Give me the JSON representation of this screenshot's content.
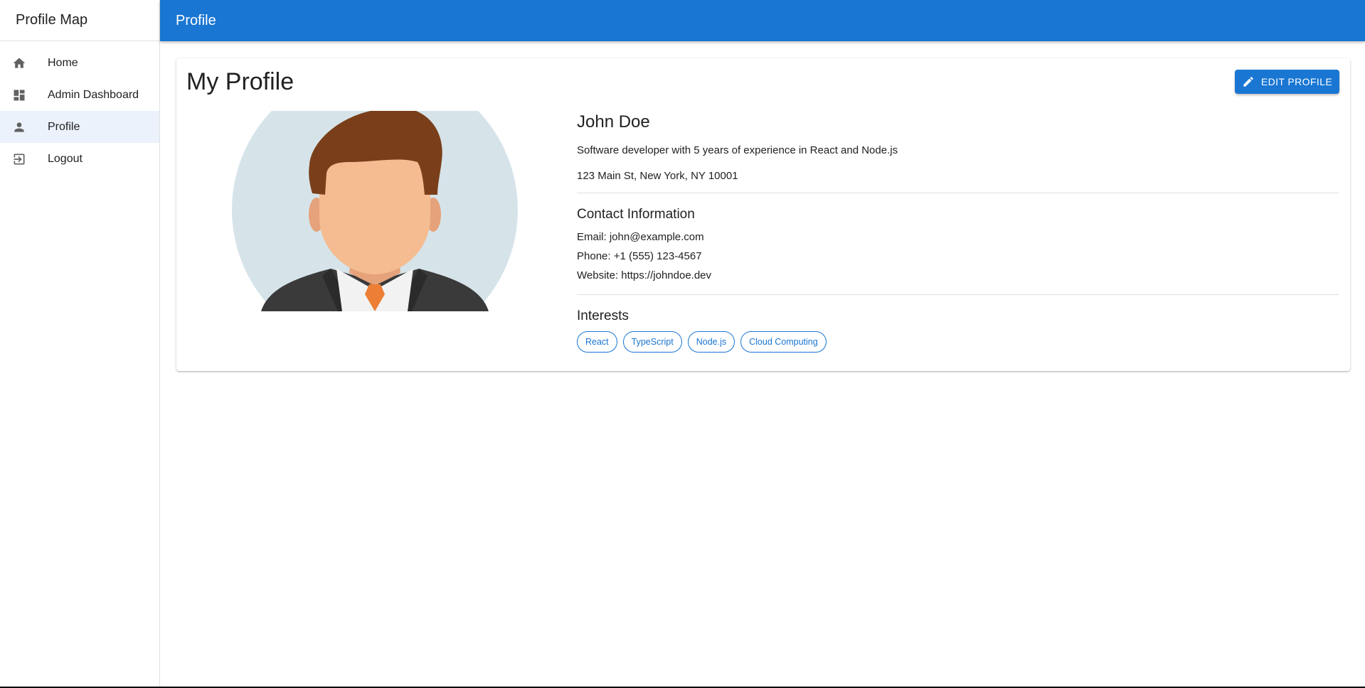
{
  "sidebar": {
    "title": "Profile Map",
    "items": [
      {
        "label": "Home",
        "icon": "home-icon"
      },
      {
        "label": "Admin Dashboard",
        "icon": "dashboard-icon"
      },
      {
        "label": "Profile",
        "icon": "person-icon",
        "selected": true
      },
      {
        "label": "Logout",
        "icon": "logout-icon"
      }
    ]
  },
  "appbar": {
    "title": "Profile"
  },
  "card": {
    "title": "My Profile",
    "edit_label": "EDIT PROFILE",
    "edit_icon": "pencil-icon",
    "avatar_icon": "person-avatar-illustration"
  },
  "profile": {
    "name": "John Doe",
    "bio": "Software developer with 5 years of experience in React and Node.js",
    "address": "123 Main St, New York, NY 10001"
  },
  "contact": {
    "heading": "Contact Information",
    "email": "Email: john@example.com",
    "phone": "Phone: +1 (555) 123-4567",
    "website": "Website: https://johndoe.dev"
  },
  "interests": {
    "heading": "Interests",
    "items": [
      "React",
      "TypeScript",
      "Node.js",
      "Cloud Computing"
    ]
  },
  "colors": {
    "primary": "#1976d2",
    "selected_bg": "#ebf2fb"
  }
}
